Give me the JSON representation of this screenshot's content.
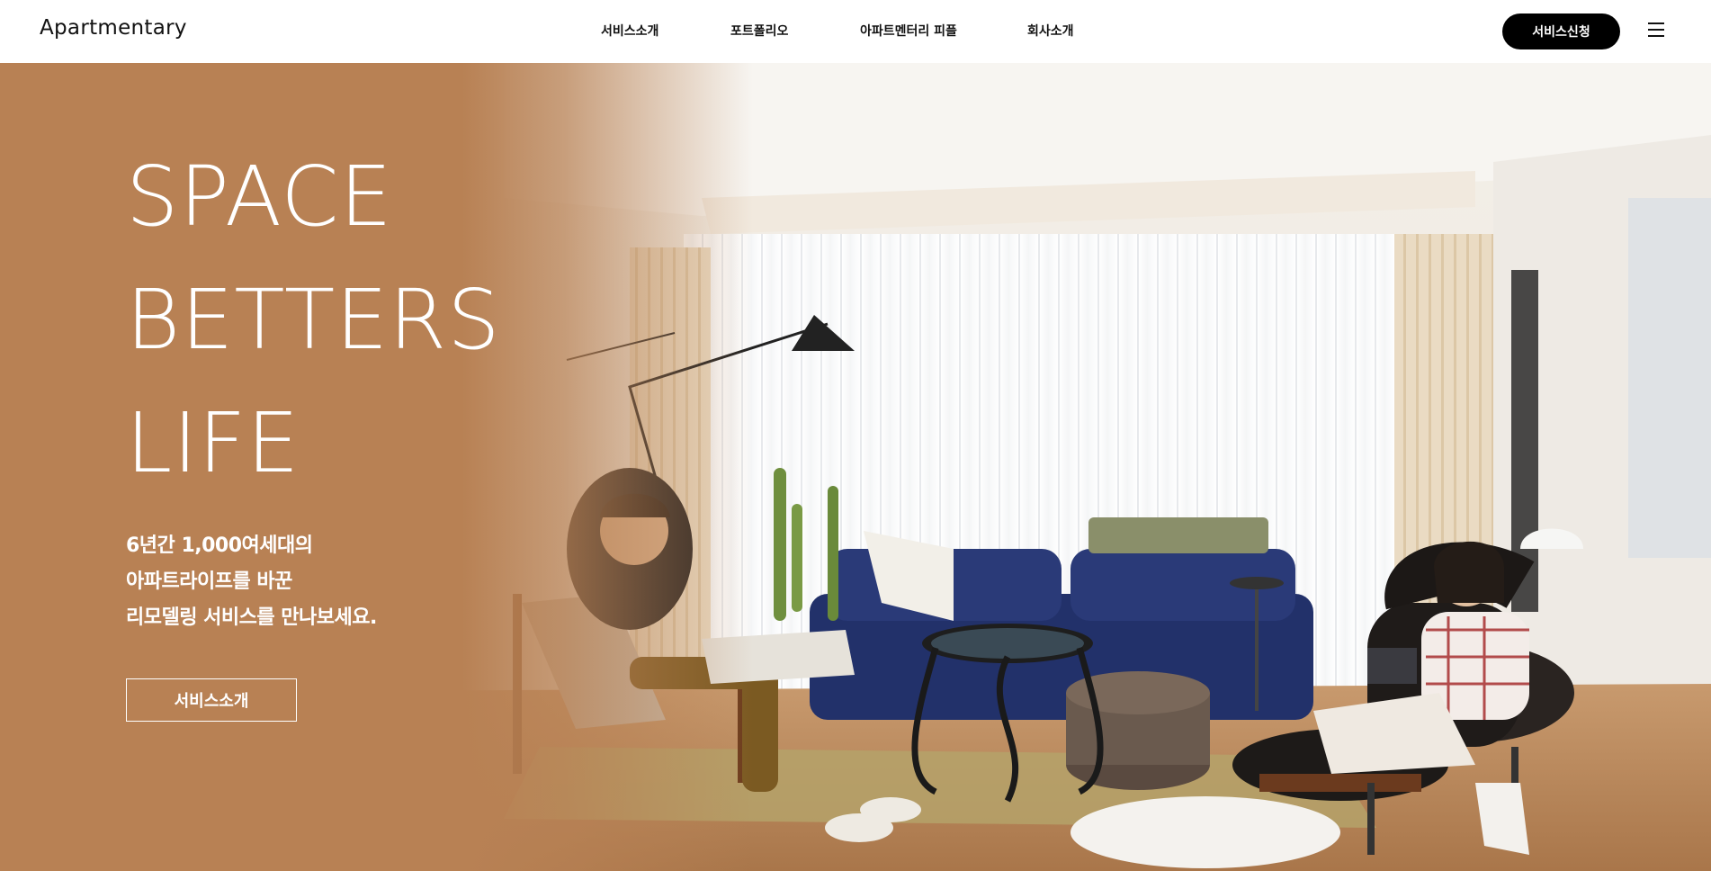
{
  "header": {
    "logo": "Apartmentary",
    "nav": [
      {
        "label": "서비스소개"
      },
      {
        "label": "포트폴리오"
      },
      {
        "label": "아파트멘터리 피플"
      },
      {
        "label": "회사소개"
      }
    ],
    "cta_label": "서비스신청"
  },
  "hero": {
    "headline": [
      "SPACE",
      "BETTERS",
      "LIFE"
    ],
    "subtext": [
      "6년간 1,000여세대의",
      "아파트라이프를 바꾼",
      "리모델링 서비스를 만나보세요."
    ],
    "button_label": "서비스소개"
  },
  "colors": {
    "overlay": "#b88154",
    "cta_bg": "#000000",
    "text_light": "#ffffff"
  },
  "icons": {
    "menu": "hamburger-menu-icon"
  }
}
